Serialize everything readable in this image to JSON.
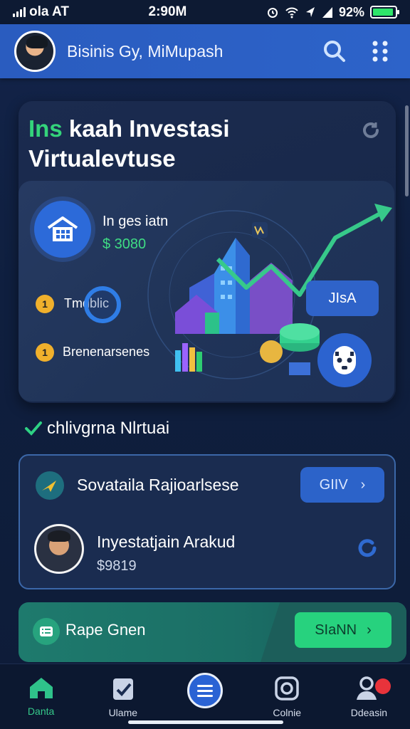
{
  "status_bar": {
    "carrier": "ola AT",
    "time": "2:90M",
    "battery_percent": "92%",
    "battery_level": 0.92
  },
  "header": {
    "title": "Bisinis Gy, MiMupash",
    "icons": [
      "avatar",
      "search-icon",
      "more-dots-icon"
    ]
  },
  "hero": {
    "title_accent": "Ins",
    "title_line1": " kaah Investasi",
    "title_line2": "Virtualevtuse",
    "stat_label": "In ges iatn",
    "stat_value": "$ 3080",
    "bullets": [
      {
        "number": "1",
        "label": "Tmdblic"
      },
      {
        "number": "1",
        "label": "Brenenarsenes"
      }
    ],
    "button_label": "JIsA",
    "colors": {
      "accent_green": "#34d47b",
      "accent_blue": "#2c6ad9"
    }
  },
  "section": {
    "heading": "chlivgrna Nlrtuai"
  },
  "recommendation": {
    "title": "Sovataila Rajioarlsese",
    "button_label": "GIIV",
    "name": "Inyestatjain Arakud",
    "amount": "$9819"
  },
  "promo": {
    "title": "Rape Gnen",
    "button_label": "SIaNN"
  },
  "nav": {
    "items": [
      {
        "label": "Danta",
        "icon": "home-icon",
        "active": true
      },
      {
        "label": "Ulame",
        "icon": "checklist-icon",
        "active": false
      },
      {
        "label": "",
        "icon": "menu-icon",
        "active": false
      },
      {
        "label": "Colnie",
        "icon": "camera-icon",
        "active": false
      },
      {
        "label": "Ddeasin",
        "icon": "profile-icon",
        "active": false
      }
    ]
  }
}
